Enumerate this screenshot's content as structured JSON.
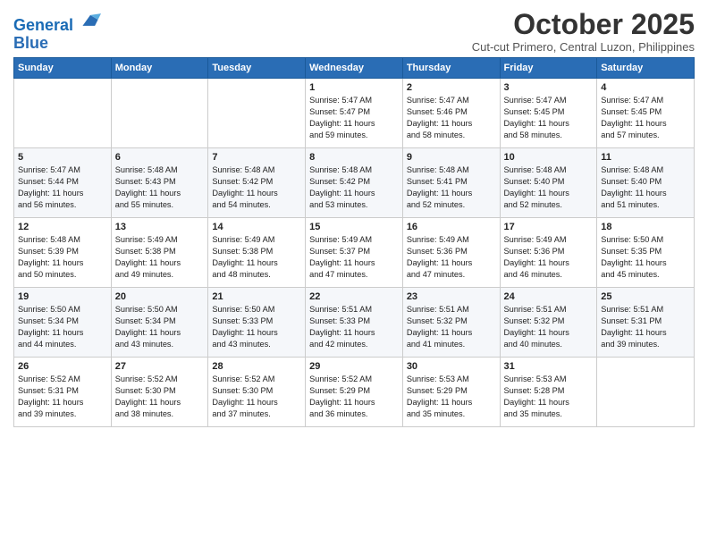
{
  "header": {
    "logo_line1": "General",
    "logo_line2": "Blue",
    "month": "October 2025",
    "location": "Cut-cut Primero, Central Luzon, Philippines"
  },
  "days_of_week": [
    "Sunday",
    "Monday",
    "Tuesday",
    "Wednesday",
    "Thursday",
    "Friday",
    "Saturday"
  ],
  "weeks": [
    [
      {
        "num": "",
        "info": ""
      },
      {
        "num": "",
        "info": ""
      },
      {
        "num": "",
        "info": ""
      },
      {
        "num": "1",
        "info": "Sunrise: 5:47 AM\nSunset: 5:47 PM\nDaylight: 11 hours\nand 59 minutes."
      },
      {
        "num": "2",
        "info": "Sunrise: 5:47 AM\nSunset: 5:46 PM\nDaylight: 11 hours\nand 58 minutes."
      },
      {
        "num": "3",
        "info": "Sunrise: 5:47 AM\nSunset: 5:45 PM\nDaylight: 11 hours\nand 58 minutes."
      },
      {
        "num": "4",
        "info": "Sunrise: 5:47 AM\nSunset: 5:45 PM\nDaylight: 11 hours\nand 57 minutes."
      }
    ],
    [
      {
        "num": "5",
        "info": "Sunrise: 5:47 AM\nSunset: 5:44 PM\nDaylight: 11 hours\nand 56 minutes."
      },
      {
        "num": "6",
        "info": "Sunrise: 5:48 AM\nSunset: 5:43 PM\nDaylight: 11 hours\nand 55 minutes."
      },
      {
        "num": "7",
        "info": "Sunrise: 5:48 AM\nSunset: 5:42 PM\nDaylight: 11 hours\nand 54 minutes."
      },
      {
        "num": "8",
        "info": "Sunrise: 5:48 AM\nSunset: 5:42 PM\nDaylight: 11 hours\nand 53 minutes."
      },
      {
        "num": "9",
        "info": "Sunrise: 5:48 AM\nSunset: 5:41 PM\nDaylight: 11 hours\nand 52 minutes."
      },
      {
        "num": "10",
        "info": "Sunrise: 5:48 AM\nSunset: 5:40 PM\nDaylight: 11 hours\nand 52 minutes."
      },
      {
        "num": "11",
        "info": "Sunrise: 5:48 AM\nSunset: 5:40 PM\nDaylight: 11 hours\nand 51 minutes."
      }
    ],
    [
      {
        "num": "12",
        "info": "Sunrise: 5:48 AM\nSunset: 5:39 PM\nDaylight: 11 hours\nand 50 minutes."
      },
      {
        "num": "13",
        "info": "Sunrise: 5:49 AM\nSunset: 5:38 PM\nDaylight: 11 hours\nand 49 minutes."
      },
      {
        "num": "14",
        "info": "Sunrise: 5:49 AM\nSunset: 5:38 PM\nDaylight: 11 hours\nand 48 minutes."
      },
      {
        "num": "15",
        "info": "Sunrise: 5:49 AM\nSunset: 5:37 PM\nDaylight: 11 hours\nand 47 minutes."
      },
      {
        "num": "16",
        "info": "Sunrise: 5:49 AM\nSunset: 5:36 PM\nDaylight: 11 hours\nand 47 minutes."
      },
      {
        "num": "17",
        "info": "Sunrise: 5:49 AM\nSunset: 5:36 PM\nDaylight: 11 hours\nand 46 minutes."
      },
      {
        "num": "18",
        "info": "Sunrise: 5:50 AM\nSunset: 5:35 PM\nDaylight: 11 hours\nand 45 minutes."
      }
    ],
    [
      {
        "num": "19",
        "info": "Sunrise: 5:50 AM\nSunset: 5:34 PM\nDaylight: 11 hours\nand 44 minutes."
      },
      {
        "num": "20",
        "info": "Sunrise: 5:50 AM\nSunset: 5:34 PM\nDaylight: 11 hours\nand 43 minutes."
      },
      {
        "num": "21",
        "info": "Sunrise: 5:50 AM\nSunset: 5:33 PM\nDaylight: 11 hours\nand 43 minutes."
      },
      {
        "num": "22",
        "info": "Sunrise: 5:51 AM\nSunset: 5:33 PM\nDaylight: 11 hours\nand 42 minutes."
      },
      {
        "num": "23",
        "info": "Sunrise: 5:51 AM\nSunset: 5:32 PM\nDaylight: 11 hours\nand 41 minutes."
      },
      {
        "num": "24",
        "info": "Sunrise: 5:51 AM\nSunset: 5:32 PM\nDaylight: 11 hours\nand 40 minutes."
      },
      {
        "num": "25",
        "info": "Sunrise: 5:51 AM\nSunset: 5:31 PM\nDaylight: 11 hours\nand 39 minutes."
      }
    ],
    [
      {
        "num": "26",
        "info": "Sunrise: 5:52 AM\nSunset: 5:31 PM\nDaylight: 11 hours\nand 39 minutes."
      },
      {
        "num": "27",
        "info": "Sunrise: 5:52 AM\nSunset: 5:30 PM\nDaylight: 11 hours\nand 38 minutes."
      },
      {
        "num": "28",
        "info": "Sunrise: 5:52 AM\nSunset: 5:30 PM\nDaylight: 11 hours\nand 37 minutes."
      },
      {
        "num": "29",
        "info": "Sunrise: 5:52 AM\nSunset: 5:29 PM\nDaylight: 11 hours\nand 36 minutes."
      },
      {
        "num": "30",
        "info": "Sunrise: 5:53 AM\nSunset: 5:29 PM\nDaylight: 11 hours\nand 35 minutes."
      },
      {
        "num": "31",
        "info": "Sunrise: 5:53 AM\nSunset: 5:28 PM\nDaylight: 11 hours\nand 35 minutes."
      },
      {
        "num": "",
        "info": ""
      }
    ]
  ]
}
